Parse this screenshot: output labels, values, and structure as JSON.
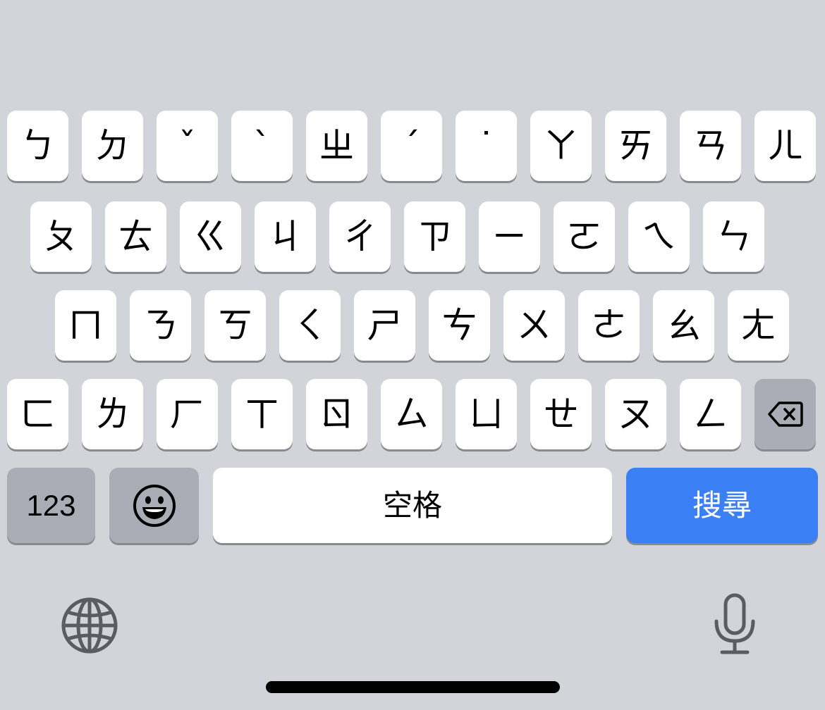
{
  "keyboard": {
    "row1": [
      "ㄅ",
      "ㄉ",
      "ˇ",
      "ˋ",
      "ㄓ",
      "ˊ",
      "˙",
      "ㄚ",
      "ㄞ",
      "ㄢ",
      "ㄦ"
    ],
    "row2": [
      "ㄆ",
      "ㄊ",
      "ㄍ",
      "ㄐ",
      "ㄔ",
      "ㄗ",
      "ㄧ",
      "ㄛ",
      "ㄟ",
      "ㄣ"
    ],
    "row3": [
      "ㄇ",
      "ㄋ",
      "ㄎ",
      "ㄑ",
      "ㄕ",
      "ㄘ",
      "ㄨ",
      "ㄜ",
      "ㄠ",
      "ㄤ"
    ],
    "row4": [
      "ㄈ",
      "ㄌ",
      "ㄏ",
      "ㄒ",
      "ㄖ",
      "ㄙ",
      "ㄩ",
      "ㄝ",
      "ㄡ",
      "ㄥ"
    ],
    "numbers_label": "123",
    "space_label": "空格",
    "search_label": "搜尋",
    "search_color": "#3a7ff3",
    "icons": {
      "delete": "delete-backward-icon",
      "emoji": "emoji-smiley-icon",
      "globe": "globe-icon",
      "mic": "microphone-icon"
    }
  }
}
